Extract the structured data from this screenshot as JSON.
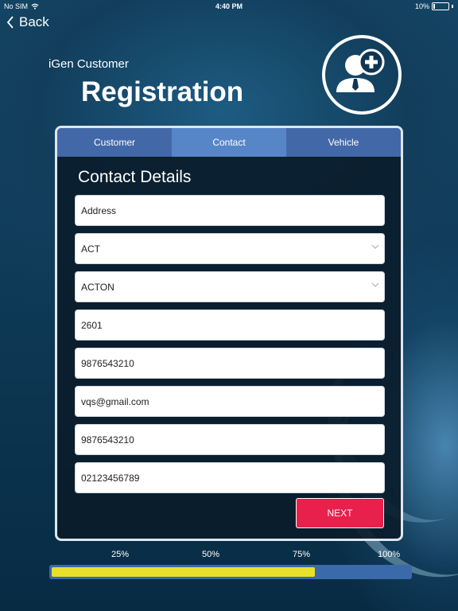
{
  "status_bar": {
    "carrier": "No SIM",
    "time": "4:40 PM",
    "battery": "10%",
    "battery_level": 0.1
  },
  "nav": {
    "back_label": "Back"
  },
  "header": {
    "subtitle": "iGen Customer",
    "title": "Registration",
    "logo_icon": "add-user-icon"
  },
  "tabs": [
    {
      "label": "Customer",
      "active": false
    },
    {
      "label": "Contact",
      "active": true
    },
    {
      "label": "Vehicle",
      "active": false
    }
  ],
  "form": {
    "title": "Contact Details",
    "address": {
      "placeholder": "Address",
      "value": ""
    },
    "state": {
      "value": "ACT"
    },
    "suburb": {
      "value": "ACTON"
    },
    "postcode": {
      "value": "2601"
    },
    "phone": {
      "value": "9876543210"
    },
    "email": {
      "value": "vqs@gmail.com"
    },
    "mobile": {
      "value": "9876543210"
    },
    "other_phone": {
      "value": "02123456789"
    },
    "next_label": "NEXT"
  },
  "progress": {
    "labels": [
      "25%",
      "50%",
      "75%",
      "100%"
    ],
    "value": 0.75
  },
  "colors": {
    "accent": "#e8204b",
    "tab_bar": "#4368a8",
    "tab_active": "#5786c8",
    "progress_fill": "#e8e02a"
  }
}
